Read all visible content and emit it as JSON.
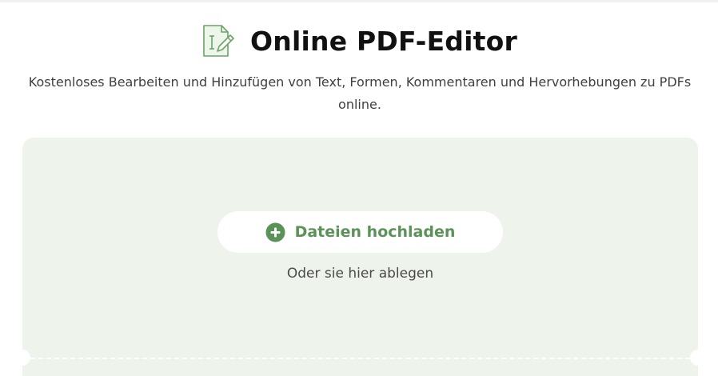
{
  "header": {
    "icon": "pdf-edit-document-icon",
    "title": "Online PDF-Editor",
    "subtitle": "Kostenloses Bearbeiten und Hinzufügen von Text, Formen, Kommentaren und Hervorhebungen zu PDFs online."
  },
  "dropzone": {
    "upload_label": "Dateien hochladen",
    "upload_icon": "plus-circle-icon",
    "hint": "Oder sie hier ablegen"
  },
  "colors": {
    "accent": "#5a9257",
    "dropzone_bg": "#eef4ec",
    "title": "#111111",
    "text": "#3f3f3f"
  }
}
